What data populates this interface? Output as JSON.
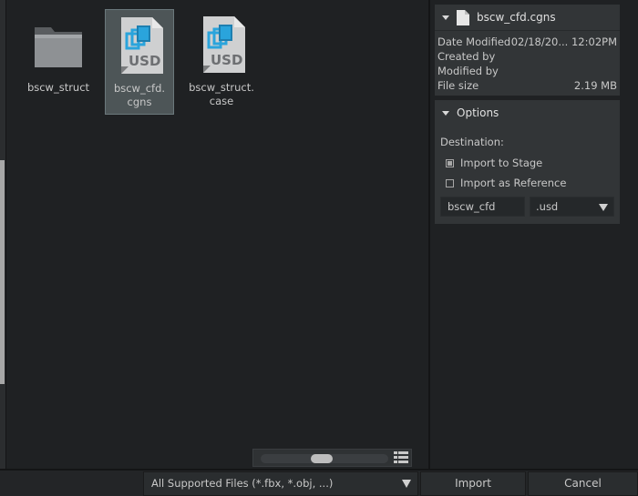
{
  "files": [
    {
      "name": "bscw_struct",
      "type": "folder",
      "selected": false
    },
    {
      "name": "bscw_cfd.\ncgns",
      "type": "usd-file",
      "selected": true,
      "badge": "USD"
    },
    {
      "name": "bscw_struct.\ncase",
      "type": "usd-file",
      "selected": false,
      "badge": "USD"
    }
  ],
  "info": {
    "filename": "bscw_cfd.cgns",
    "rows": [
      {
        "label": "Date Modified",
        "value": "02/18/20... 12:02PM"
      },
      {
        "label": "Created by",
        "value": ""
      },
      {
        "label": "Modified by",
        "value": ""
      },
      {
        "label": "File size",
        "value": "2.19 MB"
      }
    ]
  },
  "options": {
    "title": "Options",
    "destination_label": "Destination:",
    "import_to_stage": "Import to Stage",
    "import_as_reference": "Import as Reference",
    "name_value": "bscw_cfd",
    "extension_value": ".usd",
    "import_to_stage_checked": true,
    "import_as_reference_checked": false
  },
  "bottom": {
    "filter": "All Supported Files (*.fbx, *.obj, ...)",
    "import_label": "Import",
    "cancel_label": "Cancel"
  },
  "colors": {
    "usd_blue": "#2aa4dc",
    "selected_bg": "#4d5557"
  }
}
